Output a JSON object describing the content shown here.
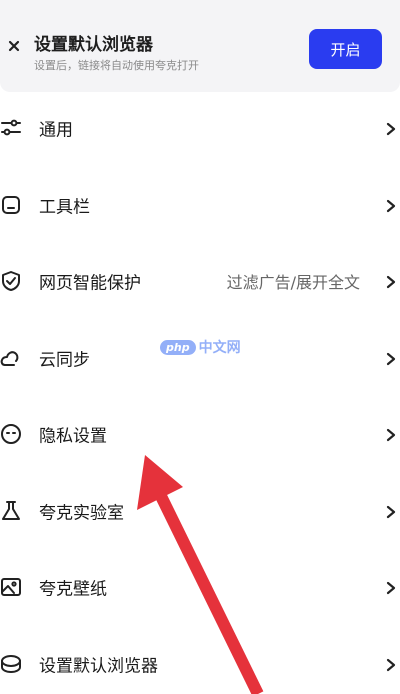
{
  "banner": {
    "title": "设置默认浏览器",
    "subtitle": "设置后，链接将自动使用夸克打开",
    "button_label": "开启",
    "close_glyph": "×"
  },
  "menu": {
    "items": [
      {
        "label": "通用",
        "icon": "sliders-icon",
        "value": ""
      },
      {
        "label": "工具栏",
        "icon": "toolbar-icon",
        "value": ""
      },
      {
        "label": "网页智能保护",
        "icon": "shield-check-icon",
        "value": "过滤广告/展开全文"
      },
      {
        "label": "云同步",
        "icon": "cloud-icon",
        "value": ""
      },
      {
        "label": "隐私设置",
        "icon": "privacy-face-icon",
        "value": ""
      },
      {
        "label": "夸克实验室",
        "icon": "flask-icon",
        "value": ""
      },
      {
        "label": "夸克壁纸",
        "icon": "wallpaper-icon",
        "value": ""
      },
      {
        "label": "设置默认浏览器",
        "icon": "default-browser-icon",
        "value": ""
      }
    ]
  },
  "watermark": {
    "pill": "php",
    "text": "中文网"
  },
  "colors": {
    "accent": "#2a3cf0",
    "arrow": "#e5323b",
    "banner_bg": "#f4f4f6"
  }
}
